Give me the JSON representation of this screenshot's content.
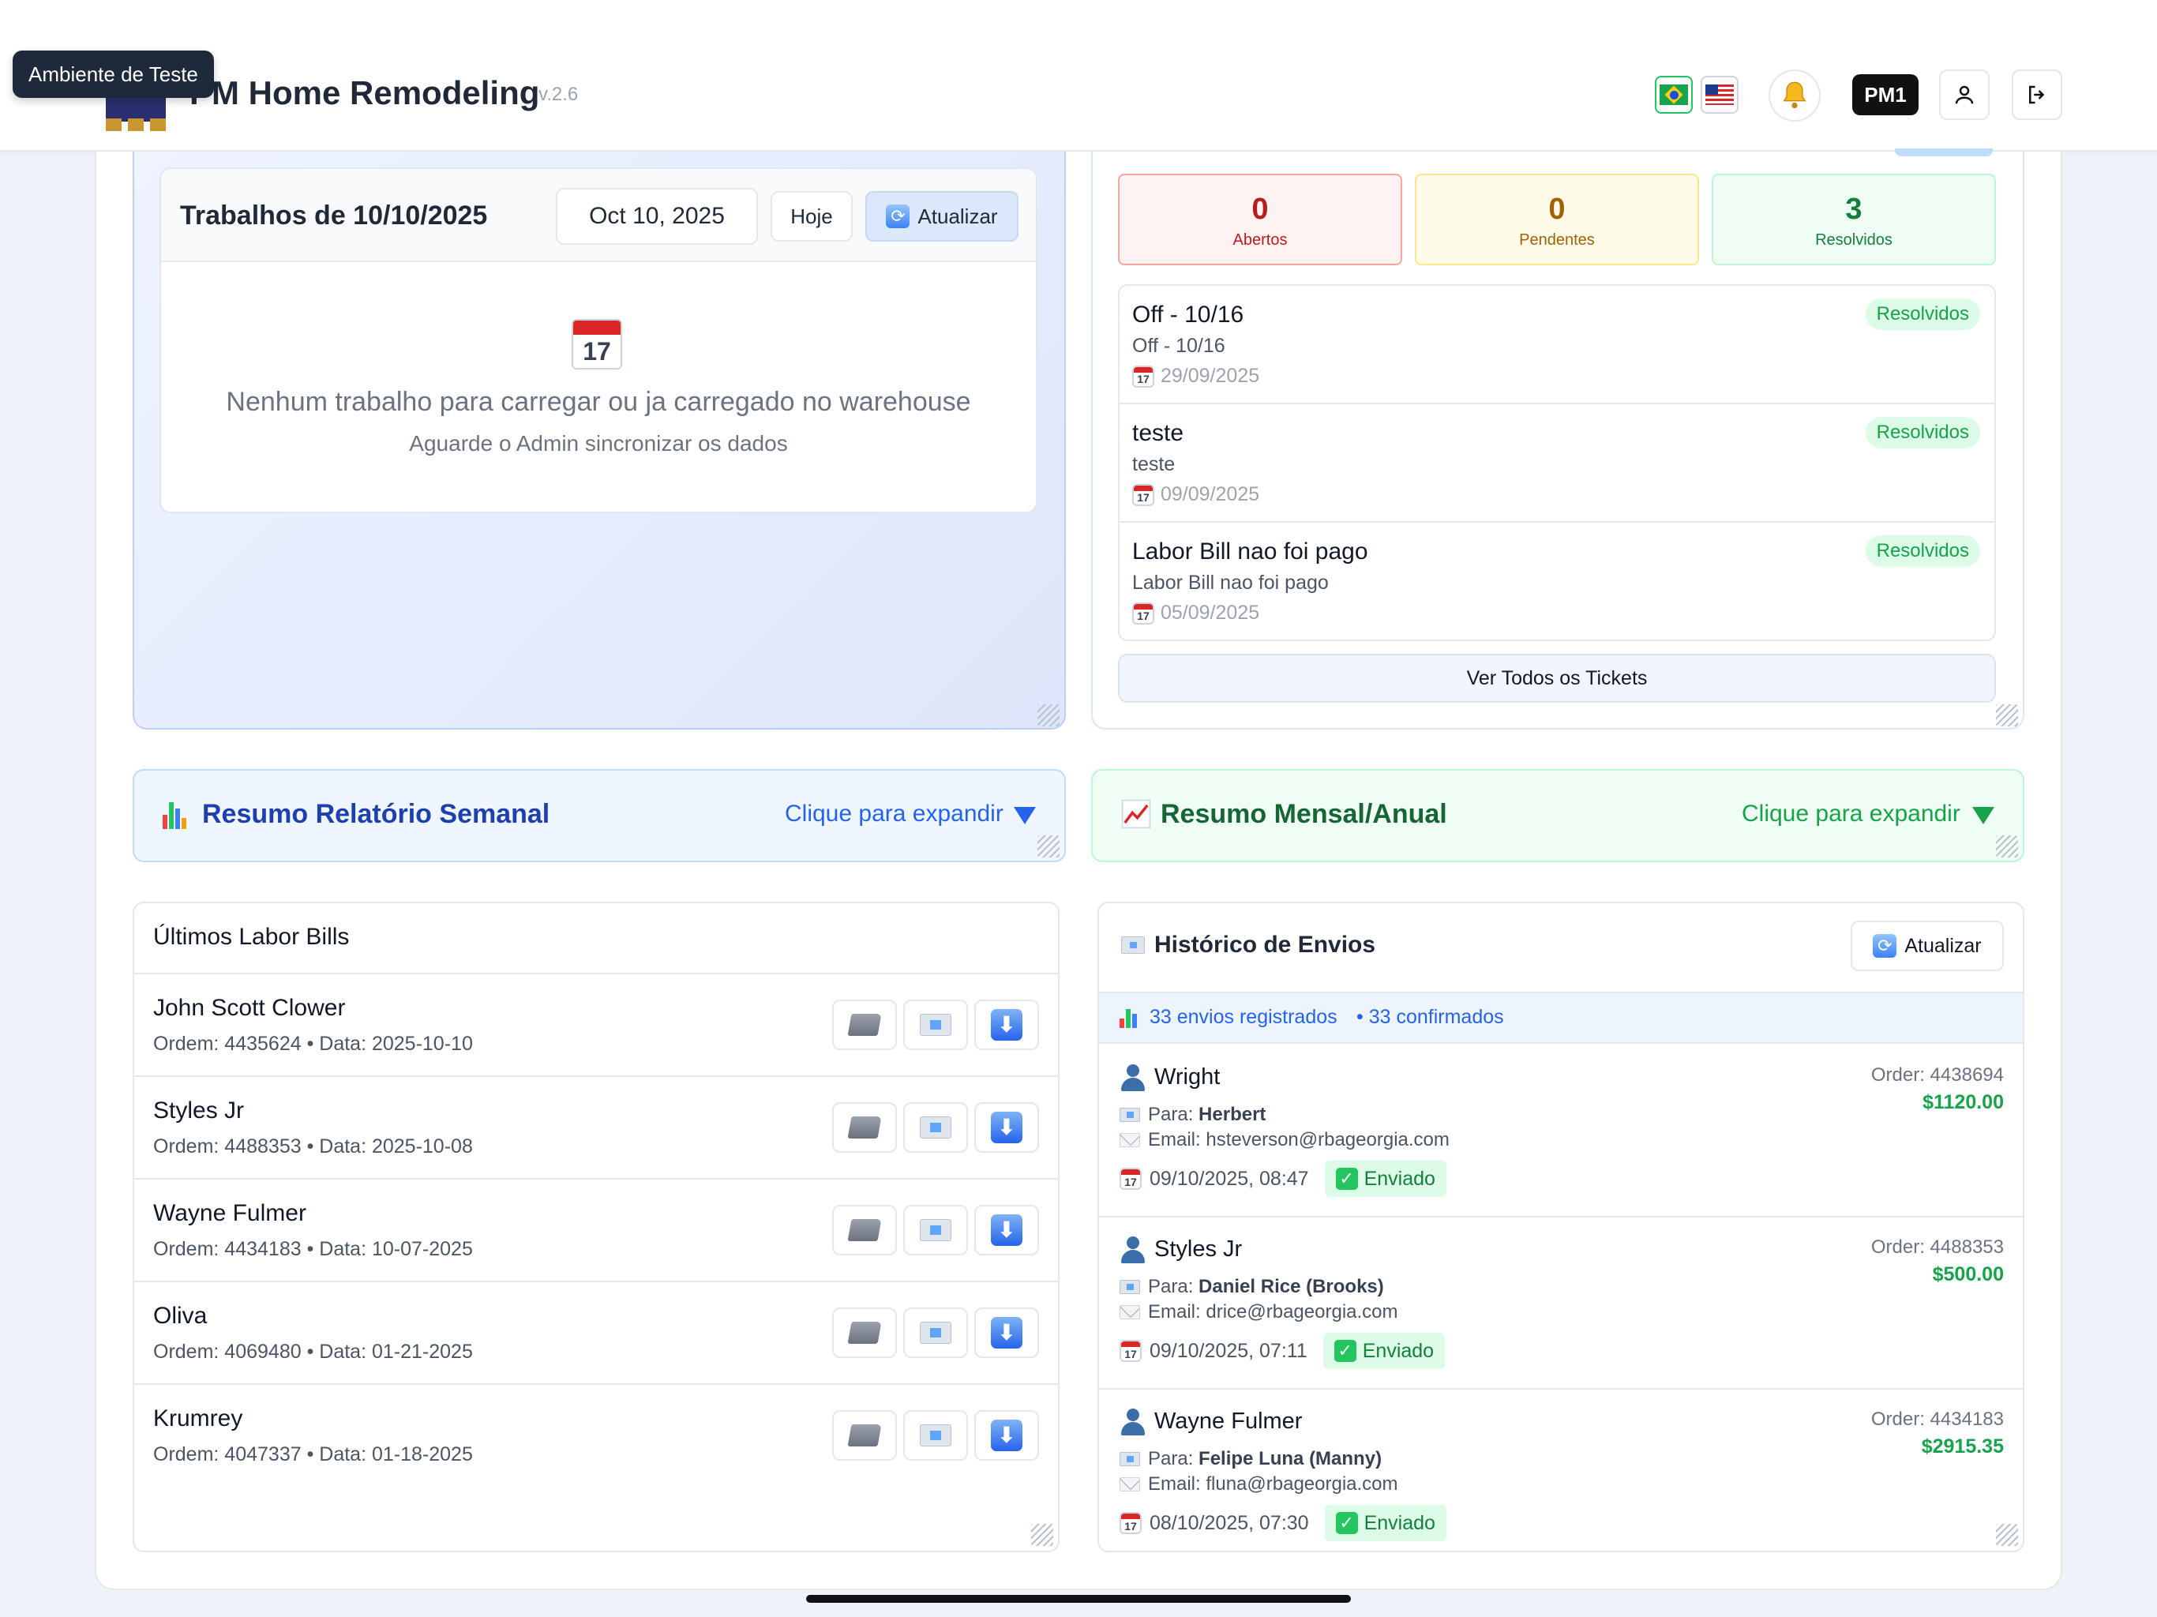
{
  "header": {
    "tooltip": "Ambiente de Teste",
    "app_title": "PM Home Remodeling",
    "version": "v.2.6",
    "user_badge": "PM1"
  },
  "jobs": {
    "title": "Trabalhos de 10/10/2025",
    "date_value": "Oct 10, 2025",
    "today_label": "Hoje",
    "refresh_label": "Atualizar",
    "calendar_day": "17",
    "empty_message": "Nenhum trabalho para carregar ou ja carregado no warehouse",
    "empty_sub": "Aguarde o Admin sincronizar os dados"
  },
  "tickets": {
    "stats": [
      {
        "value": "0",
        "label": "Abertos"
      },
      {
        "value": "0",
        "label": "Pendentes"
      },
      {
        "value": "3",
        "label": "Resolvidos"
      }
    ],
    "items": [
      {
        "title": "Off - 10/16",
        "desc": "Off - 10/16",
        "date": "29/09/2025",
        "status": "Resolvidos"
      },
      {
        "title": "teste",
        "desc": "teste",
        "date": "09/09/2025",
        "status": "Resolvidos"
      },
      {
        "title": "Labor Bill nao foi pago",
        "desc": "Labor Bill nao foi pago",
        "date": "05/09/2025",
        "status": "Resolvidos"
      }
    ],
    "view_all_label": "Ver Todos os Tickets"
  },
  "weekly": {
    "title": "Resumo Relatório Semanal",
    "hint": "Clique para expandir"
  },
  "monthly": {
    "title": "Resumo Mensal/Anual",
    "hint": "Clique para expandir"
  },
  "labor_bills": {
    "title": "Últimos Labor Bills",
    "rows": [
      {
        "name": "John Scott Clower",
        "meta": "Ordem: 4435624 • Data: 2025-10-10"
      },
      {
        "name": "Styles Jr",
        "meta": "Ordem: 4488353 • Data: 2025-10-08"
      },
      {
        "name": "Wayne Fulmer",
        "meta": "Ordem: 4434183 • Data: 10-07-2025"
      },
      {
        "name": "Oliva",
        "meta": "Ordem: 4069480 • Data: 01-21-2025"
      },
      {
        "name": "Krumrey",
        "meta": "Ordem: 4047337 • Data: 01-18-2025"
      }
    ]
  },
  "history": {
    "title": "Histórico de Envios",
    "refresh_label": "Atualizar",
    "summary_registered": "33 envios registrados",
    "summary_confirmed": "• 33 confirmados",
    "para_label": "Para:",
    "email_label": "Email:",
    "rows": [
      {
        "name": "Wright",
        "to": "Herbert",
        "email": "hsteverson@rbageorgia.com",
        "datetime": "09/10/2025, 08:47",
        "status": "Enviado",
        "order": "Order: 4438694",
        "amount": "$1120.00"
      },
      {
        "name": "Styles Jr",
        "to": "Daniel Rice (Brooks)",
        "email": "drice@rbageorgia.com",
        "datetime": "09/10/2025, 07:11",
        "status": "Enviado",
        "order": "Order: 4488353",
        "amount": "$500.00"
      },
      {
        "name": "Wayne Fulmer",
        "to": "Felipe Luna (Manny)",
        "email": "fluna@rbageorgia.com",
        "datetime": "08/10/2025, 07:30",
        "status": "Enviado",
        "order": "Order: 4434183",
        "amount": "$2915.35"
      }
    ]
  },
  "icons": {
    "calendar": "calendar-icon",
    "refresh": "refresh-icon",
    "bell": "bell-icon",
    "user": "user-icon",
    "logout": "logout-icon",
    "folder": "folder-icon",
    "envelope": "envelope-icon",
    "download": "download-icon",
    "bar_chart": "bar-chart-icon",
    "line_chart": "line-chart-icon",
    "person": "person-icon",
    "check": "check-icon"
  },
  "colors": {
    "accent_blue": "#2563eb",
    "success_green": "#16a34a",
    "danger_red": "#b91c1c",
    "warning_yellow": "#a16207"
  }
}
